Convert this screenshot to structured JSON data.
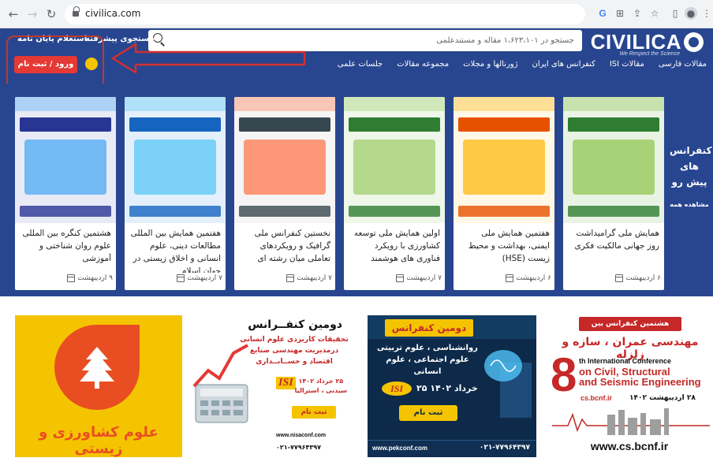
{
  "browser": {
    "url": "civilica.com"
  },
  "header": {
    "logo_text": "CIVILICA",
    "logo_tagline": "We Respect the Science",
    "search_placeholder": "جستجو در ۱،۶۲۳،۱۰۱ مقاله و مستندعلمی",
    "advanced_search": "جستجوی پیشرفته",
    "certificate_inquiry": "استعلام پایان نامه",
    "login_label": "ورود / ثبت نام",
    "nav": [
      "مقالات فارسی",
      "مقالات ISI",
      "کنفرانس های ایران",
      "ژورنالها و مجلات",
      "مجموعه مقالات",
      "جلسات علمی"
    ]
  },
  "upcoming": {
    "title": "کنفرانس های پیش رو",
    "view_all": "مشاهده همه"
  },
  "conferences": [
    {
      "title": "همایش ملی گرامیداشت روز جهانی مالکیت فکری",
      "date": "۶ اردیبهشت",
      "colors": [
        "#e9f3e4",
        "#2e7d32",
        "#8bc34a"
      ]
    },
    {
      "title": "هفتمین همایش ملی ایمنی، بهداشت و محیط زیست (HSE)",
      "date": "۶ اردیبهشت",
      "colors": [
        "#fff8e6",
        "#e65100",
        "#ffb300"
      ]
    },
    {
      "title": "اولین همایش ملی توسعه کشاورزی با رویکرد فناوری های هوشمند",
      "date": "۷ اردیبهشت",
      "colors": [
        "#eef7e8",
        "#2e7d32",
        "#9ccc65"
      ]
    },
    {
      "title": "نخستین کنفرانس ملی گرافیک و رویکردهای تعاملی میان رشته ای",
      "date": "۷ اردیبهشت",
      "colors": [
        "#f5f5f5",
        "#37474f",
        "#ff7043"
      ]
    },
    {
      "title": "هفتمین همایش بین المللی مطالعات دینی، علوم انسانی و اخلاق زیستی در جهان اسلام",
      "date": "۷ اردیبهشت",
      "colors": [
        "#e3f0fb",
        "#1565c0",
        "#4fc3f7"
      ]
    },
    {
      "title": "هشتمین کنگره بین المللی علوم روان شناختی و آموزشی",
      "date": "۹ اردیبهشت",
      "colors": [
        "#e8eaf6",
        "#283593",
        "#42a5f5"
      ]
    }
  ],
  "ads": {
    "agri_text": "علوم کشاورزی و زیستی",
    "social_head": "دومین کنفــرانس",
    "social_sub": [
      "تحقیقات کاربردی علوم انسانی",
      "درمدیریت مهندسی صنایع",
      "اقتصاد و حســابــداری"
    ],
    "social_date": "۲۵ خرداد ۱۴۰۲",
    "social_place": "سیدنی ، استرالیا",
    "isi": "ISI",
    "register": "ثبت نام",
    "social_web": "www.nisaconf.com",
    "social_tel": "۰۲۱-۷۷۹۶۴۳۹۷",
    "psych_head": "دومین کنفرانس",
    "psych_sub": [
      "روانشناسی ، علوم تربیتی",
      "علوم اجتماعی ، علوم انسانی"
    ],
    "psych_date": "۲۵ خرداد ۱۴۰۲",
    "psych_web": "www.pekconf.com",
    "psych_tel": "۰۲۱-۷۷۹۶۴۳۹۷",
    "civil_top": "هشتمین کنفرانس بین المللی",
    "civil_head": "مهندسی عمران ، سازه و زلزله",
    "civil_8": "8",
    "civil_en1": "th International Conference",
    "civil_en2": "on Civil, Structural",
    "civil_en3": "and Seismic Engineering",
    "civil_site": "cs.bcnf.ir",
    "civil_date": "۲۸ اردیبهشت ۱۴۰۲",
    "civil_url": "www.cs.bcnf.ir"
  }
}
